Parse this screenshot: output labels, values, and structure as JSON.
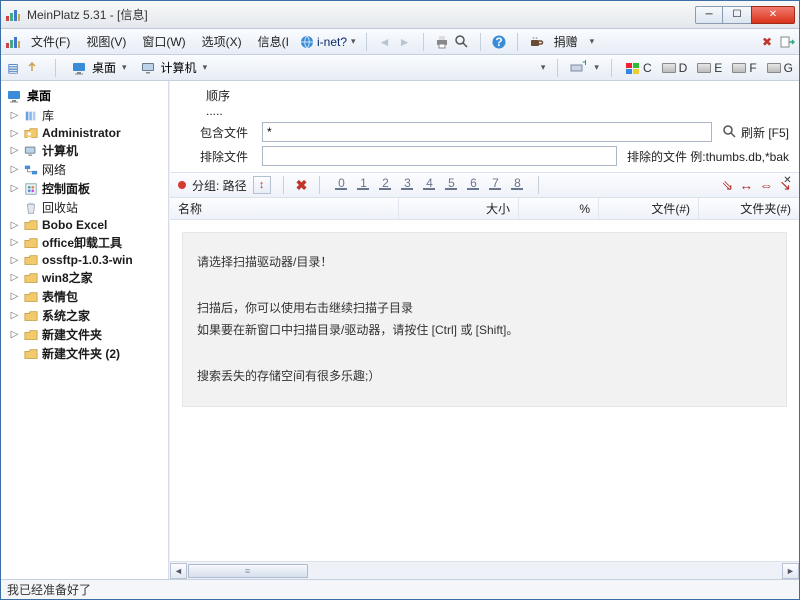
{
  "window": {
    "title": "MeinPlatz 5.31 - [信息]"
  },
  "menu": {
    "file": "文件(F)",
    "view": "视图(V)",
    "window": "窗口(W)",
    "options": "选项(X)",
    "info": "信息(I",
    "inet": "i-net?",
    "donate": "捐赠"
  },
  "toolbar2": {
    "desktop": "桌面",
    "computer": "计算机",
    "drives": [
      "C",
      "D",
      "E",
      "F",
      "G"
    ]
  },
  "tree": {
    "root": "桌面",
    "items": [
      {
        "label": "库",
        "bold": false,
        "exp": "▷",
        "ico": "lib"
      },
      {
        "label": "Administrator",
        "bold": true,
        "exp": "▷",
        "ico": "user"
      },
      {
        "label": "计算机",
        "bold": true,
        "exp": "▷",
        "ico": "pc"
      },
      {
        "label": "网络",
        "bold": false,
        "exp": "▷",
        "ico": "net"
      },
      {
        "label": "控制面板",
        "bold": true,
        "exp": "▷",
        "ico": "cp"
      },
      {
        "label": "回收站",
        "bold": false,
        "exp": "",
        "ico": "bin"
      },
      {
        "label": "Bobo Excel",
        "bold": true,
        "exp": "▷",
        "ico": "folder"
      },
      {
        "label": "office卸载工具",
        "bold": true,
        "exp": "▷",
        "ico": "folder"
      },
      {
        "label": "ossftp-1.0.3-win",
        "bold": true,
        "exp": "▷",
        "ico": "folder"
      },
      {
        "label": "win8之家",
        "bold": true,
        "exp": "▷",
        "ico": "folder"
      },
      {
        "label": "表情包",
        "bold": true,
        "exp": "▷",
        "ico": "folder"
      },
      {
        "label": "系统之家",
        "bold": true,
        "exp": "▷",
        "ico": "folder"
      },
      {
        "label": "新建文件夹",
        "bold": true,
        "exp": "▷",
        "ico": "folder"
      },
      {
        "label": "新建文件夹 (2)",
        "bold": true,
        "exp": "",
        "ico": "folder"
      }
    ]
  },
  "filter": {
    "sequence_label": "顺序",
    "sequence_value": ".....",
    "include_label": "包含文件",
    "include_value": "*",
    "exclude_label": "排除文件",
    "exclude_value": "",
    "refresh_label": "刷新  [F5]",
    "exclude_hint": "排除的文件 例:thumbs.db,*bak"
  },
  "group_row": {
    "group_label": "分组: 路径",
    "steps": [
      "0",
      "1",
      "2",
      "3",
      "4",
      "5",
      "6",
      "7",
      "8"
    ]
  },
  "columns": {
    "name": "名称",
    "size": "大小",
    "pct": "%",
    "files": "文件(#)",
    "folders": "文件夹(#)"
  },
  "info": {
    "line1": "请选择扫描驱动器/目录！",
    "line2": "扫描后，你可以使用右击继续扫描子目录",
    "line3": "如果要在新窗口中扫描目录/驱动器，请按住 [Ctrl] 或 [Shift]。",
    "line4": "搜索丢失的存储空间有很多乐趣;）"
  },
  "status": "我已经准备好了"
}
